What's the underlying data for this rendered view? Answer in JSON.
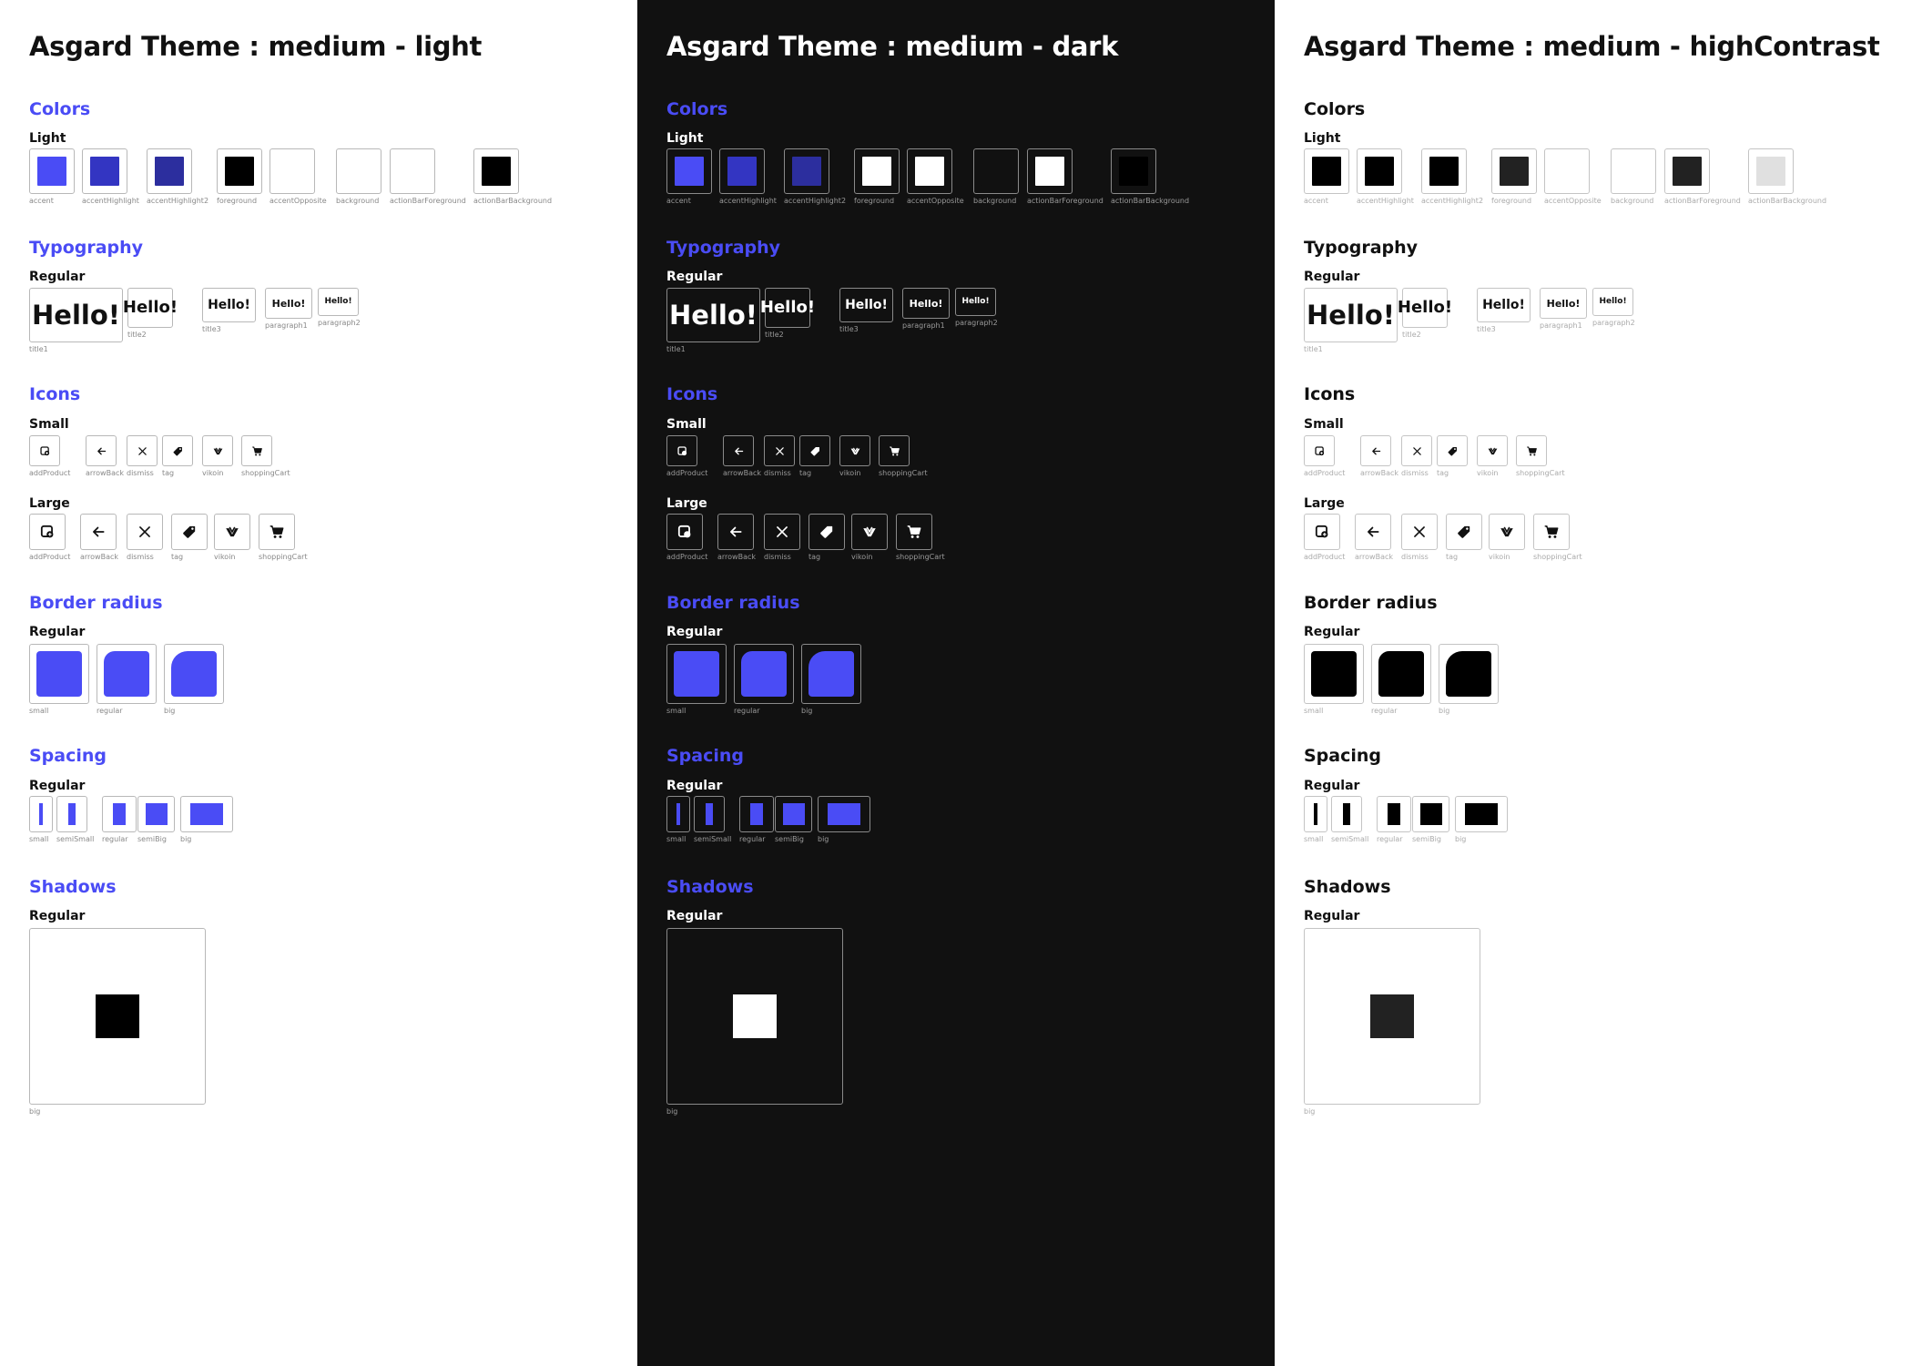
{
  "panels": [
    {
      "title": "Asgard Theme : medium - light",
      "colors": {
        "heading": "Colors",
        "sub": "Light",
        "swatches": [
          {
            "name": "accent",
            "color": "#4A4CF5"
          },
          {
            "name": "accentHighlight",
            "color": "#3335C2"
          },
          {
            "name": "accentHighlight2",
            "color": "#2C2E9E"
          },
          {
            "name": "foreground",
            "color": "#000000"
          },
          {
            "name": "accentOpposite",
            "color": "#FFFFFF"
          },
          {
            "name": "background",
            "color": "#FFFFFF"
          },
          {
            "name": "actionBarForeground",
            "color": "#FFFFFF"
          },
          {
            "name": "actionBarBackground",
            "color": "#000000"
          }
        ]
      },
      "typography": {
        "heading": "Typography",
        "sub": "Regular",
        "sample": "Hello!",
        "styles": [
          "title1",
          "title2",
          "title3",
          "paragraph1",
          "paragraph2"
        ]
      },
      "icons": {
        "heading": "Icons",
        "small_label": "Small",
        "large_label": "Large",
        "names": [
          "addProduct",
          "arrowBack",
          "dismiss",
          "tag",
          "vikoin",
          "shoppingCart"
        ]
      },
      "radius": {
        "heading": "Border radius",
        "sub": "Regular",
        "names": [
          "small",
          "regular",
          "big"
        ],
        "fill": "#4A4CF5"
      },
      "spacing": {
        "heading": "Spacing",
        "sub": "Regular",
        "names": [
          "small",
          "semiSmall",
          "regular",
          "semiBig",
          "big"
        ],
        "fill": "#4A4CF5"
      },
      "shadows": {
        "heading": "Shadows",
        "sub": "Regular",
        "name": "big",
        "fill": "#000000"
      },
      "heading_color": "#4A4CF5"
    },
    {
      "title": "Asgard Theme : medium - dark",
      "colors": {
        "heading": "Colors",
        "sub": "Light",
        "swatches": [
          {
            "name": "accent",
            "color": "#4A4CF5"
          },
          {
            "name": "accentHighlight",
            "color": "#3335C2"
          },
          {
            "name": "accentHighlight2",
            "color": "#2C2E9E"
          },
          {
            "name": "foreground",
            "color": "#FFFFFF"
          },
          {
            "name": "accentOpposite",
            "color": "#FFFFFF"
          },
          {
            "name": "background",
            "color": "#111111"
          },
          {
            "name": "actionBarForeground",
            "color": "#FFFFFF"
          },
          {
            "name": "actionBarBackground",
            "color": "#000000"
          }
        ]
      },
      "typography": {
        "heading": "Typography",
        "sub": "Regular",
        "sample": "Hello!",
        "styles": [
          "title1",
          "title2",
          "title3",
          "paragraph1",
          "paragraph2"
        ]
      },
      "icons": {
        "heading": "Icons",
        "small_label": "Small",
        "large_label": "Large",
        "names": [
          "addProduct",
          "arrowBack",
          "dismiss",
          "tag",
          "vikoin",
          "shoppingCart"
        ]
      },
      "radius": {
        "heading": "Border radius",
        "sub": "Regular",
        "names": [
          "small",
          "regular",
          "big"
        ],
        "fill": "#4A4CF5"
      },
      "spacing": {
        "heading": "Spacing",
        "sub": "Regular",
        "names": [
          "small",
          "semiSmall",
          "regular",
          "semiBig",
          "big"
        ],
        "fill": "#4A4CF5"
      },
      "shadows": {
        "heading": "Shadows",
        "sub": "Regular",
        "name": "big",
        "fill": "#FFFFFF"
      },
      "heading_color": "#4A4CF5"
    },
    {
      "title": "Asgard Theme : medium - highContrast",
      "colors": {
        "heading": "Colors",
        "sub": "Light",
        "swatches": [
          {
            "name": "accent",
            "color": "#000000"
          },
          {
            "name": "accentHighlight",
            "color": "#000000"
          },
          {
            "name": "accentHighlight2",
            "color": "#000000"
          },
          {
            "name": "foreground",
            "color": "#222222"
          },
          {
            "name": "accentOpposite",
            "color": "#FFFFFF"
          },
          {
            "name": "background",
            "color": "#FFFFFF"
          },
          {
            "name": "actionBarForeground",
            "color": "#222222"
          },
          {
            "name": "actionBarBackground",
            "color": "#E0E0E0"
          }
        ]
      },
      "typography": {
        "heading": "Typography",
        "sub": "Regular",
        "sample": "Hello!",
        "styles": [
          "title1",
          "title2",
          "title3",
          "paragraph1",
          "paragraph2"
        ]
      },
      "icons": {
        "heading": "Icons",
        "small_label": "Small",
        "large_label": "Large",
        "names": [
          "addProduct",
          "arrowBack",
          "dismiss",
          "tag",
          "vikoin",
          "shoppingCart"
        ]
      },
      "radius": {
        "heading": "Border radius",
        "sub": "Regular",
        "names": [
          "small",
          "regular",
          "big"
        ],
        "fill": "#000000"
      },
      "spacing": {
        "heading": "Spacing",
        "sub": "Regular",
        "names": [
          "small",
          "semiSmall",
          "regular",
          "semiBig",
          "big"
        ],
        "fill": "#000000"
      },
      "shadows": {
        "heading": "Shadows",
        "sub": "Regular",
        "name": "big",
        "fill": "#222222"
      },
      "heading_color": "#111111"
    }
  ],
  "icon_glyphs": {
    "addProduct": "add-product-icon",
    "arrowBack": "arrow-back-icon",
    "dismiss": "dismiss-icon",
    "tag": "tag-icon",
    "vikoin": "vikoin-icon",
    "shoppingCart": "shopping-cart-icon"
  }
}
